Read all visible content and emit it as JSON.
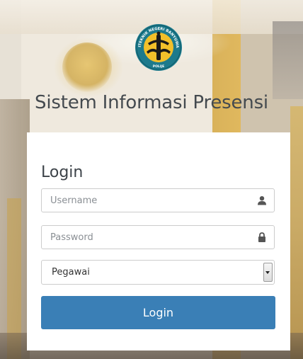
{
  "app_title": "Sistem Informasi Presensi",
  "logo": {
    "icon": "institution-seal-icon",
    "ring_text_top": "POLITEKNIK NEGERI BANYUWANGI",
    "ring_text_bottom": "POLIJE",
    "colors": {
      "ring": "#1d7a8c",
      "inner": "#f2c02a",
      "dark": "#1a1a1a"
    }
  },
  "login_panel": {
    "heading": "Login",
    "username": {
      "placeholder": "Username",
      "value": "",
      "icon": "user-icon"
    },
    "password": {
      "placeholder": "Password",
      "value": "",
      "icon": "lock-icon"
    },
    "role_select": {
      "selected": "Pegawai",
      "icon": "dropdown-arrow-icon"
    },
    "submit_label": "Login"
  },
  "colors": {
    "primary_button": "#3a7fb6",
    "title_text": "#444a4f",
    "panel_bg": "#ffffff"
  }
}
